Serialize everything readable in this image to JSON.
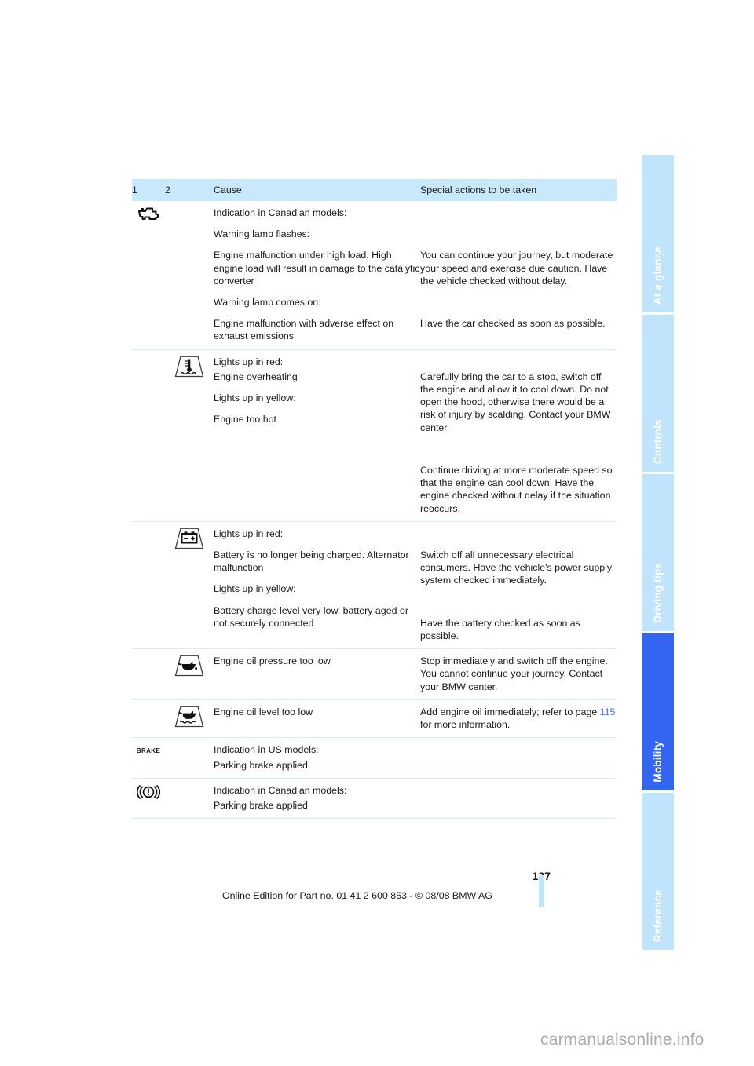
{
  "document": {
    "page_number": "137",
    "footer_note": "Online Edition for Part no. 01 41 2 600 853 - © 08/08 BMW AG",
    "watermark": "carmanualsonline.info"
  },
  "side_tabs": [
    {
      "label": "At a glance",
      "active": false
    },
    {
      "label": "Controls",
      "active": false
    },
    {
      "label": "Driving tips",
      "active": false
    },
    {
      "label": "Mobility",
      "active": true
    },
    {
      "label": "Reference",
      "active": false
    }
  ],
  "table": {
    "headers": {
      "col1": "1",
      "col2": "2",
      "col3": "Cause",
      "col4": "Special actions to be taken"
    },
    "rows": [
      {
        "icon_col": 1,
        "icon": "engine-check-icon",
        "blocks": [
          {
            "cause": "Indication in Canadian models:",
            "action": ""
          },
          {
            "cause": "Warning lamp flashes:",
            "action": ""
          },
          {
            "cause": "Engine malfunction under high load. High engine load will result in damage to the catalytic converter",
            "action": "You can continue your journey, but moderate your speed and exercise due caution. Have the vehicle checked without delay."
          },
          {
            "cause": "Warning lamp comes on:",
            "action": ""
          },
          {
            "cause": "Engine malfunction with adverse effect on exhaust emissions",
            "action": "Have the car checked as soon as possible."
          }
        ]
      },
      {
        "icon_col": 2,
        "icon": "coolant-temperature-icon",
        "blocks": [
          {
            "cause": "Lights up in red:",
            "action": "",
            "tight": true
          },
          {
            "cause": "Engine overheating",
            "action": "Carefully bring the car to a stop, switch off the engine and allow it to cool down. Do not open the hood, otherwise there would be a risk of injury by scalding. Contact your BMW center.",
            "tight": true
          },
          {
            "cause": "Lights up in yellow:",
            "action": ""
          },
          {
            "cause": "Engine too hot",
            "action": "Continue driving at more moderate speed so that the engine can cool down. Have the engine checked without delay if the situation reoccurs."
          }
        ]
      },
      {
        "icon_col": 2,
        "icon": "battery-icon",
        "blocks": [
          {
            "cause": "Lights up in red:",
            "action": ""
          },
          {
            "cause": "Battery is no longer being charged. Alternator malfunction",
            "action": "Switch off all unnecessary electrical consumers. Have the vehicle's power supply system checked immediately."
          },
          {
            "cause": "Lights up in yellow:",
            "action": ""
          },
          {
            "cause": "Battery charge level very low, battery aged or not securely connected",
            "action": "Have the battery checked as soon as possible."
          }
        ]
      },
      {
        "icon_col": 2,
        "icon": "oil-pressure-icon",
        "blocks": [
          {
            "cause": "Engine oil pressure too low",
            "action": "Stop immediately and switch off the engine. You cannot continue your journey. Contact your BMW center."
          }
        ]
      },
      {
        "icon_col": 2,
        "icon": "oil-level-icon",
        "blocks": [
          {
            "cause": "Engine oil level too low",
            "action_pre": "Add engine oil immediately; refer to page ",
            "action_link": "115",
            "action_post": " for more information."
          }
        ]
      },
      {
        "icon_col": 1,
        "icon": "brake-text-icon",
        "icon_text": "BRAKE",
        "blocks": [
          {
            "cause": "Indication in US models:",
            "action": "",
            "tight": true
          },
          {
            "cause": "Parking brake applied",
            "action": "",
            "tight": true
          }
        ]
      },
      {
        "icon_col": 1,
        "icon": "parking-brake-icon",
        "blocks": [
          {
            "cause": "Indication in Canadian models:",
            "action": "",
            "tight": true
          },
          {
            "cause": "Parking brake applied",
            "action": "",
            "tight": true
          }
        ]
      }
    ]
  }
}
